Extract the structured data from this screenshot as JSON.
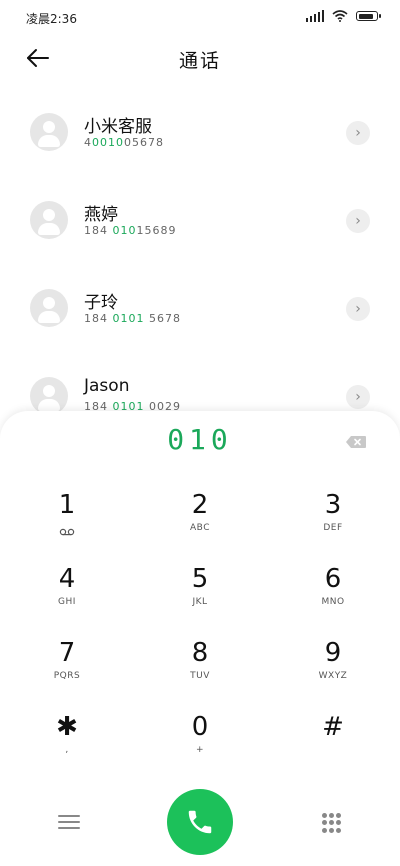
{
  "status": {
    "time": "凌晨2:36",
    "battery_level": 0.9
  },
  "header": {
    "title": "通话",
    "back_icon": "arrow-left-icon"
  },
  "contacts": [
    {
      "name": "小米客服",
      "number_parts": [
        "4",
        "0010",
        "05678"
      ]
    },
    {
      "name": "燕婷",
      "number_parts": [
        "184 ",
        "010",
        "15689"
      ]
    },
    {
      "name": "子玲",
      "number_parts": [
        "184 ",
        "0101",
        " 5678"
      ]
    },
    {
      "name": "Jason",
      "number_parts": [
        "184 ",
        "0101",
        " 0029"
      ]
    }
  ],
  "dialer": {
    "entered": "010",
    "keys": [
      {
        "digit": "1",
        "letters": "voicemail-icon"
      },
      {
        "digit": "2",
        "letters": "ABC"
      },
      {
        "digit": "3",
        "letters": "DEF"
      },
      {
        "digit": "4",
        "letters": "GHI"
      },
      {
        "digit": "5",
        "letters": "JKL"
      },
      {
        "digit": "6",
        "letters": "MNO"
      },
      {
        "digit": "7",
        "letters": "PQRS"
      },
      {
        "digit": "8",
        "letters": "TUV"
      },
      {
        "digit": "9",
        "letters": "WXYZ"
      },
      {
        "digit": "✱",
        "letters": ","
      },
      {
        "digit": "0",
        "letters": "+"
      },
      {
        "digit": "#",
        "letters": ""
      }
    ]
  },
  "colors": {
    "accent": "#1ba85a",
    "call": "#1cc15a"
  }
}
